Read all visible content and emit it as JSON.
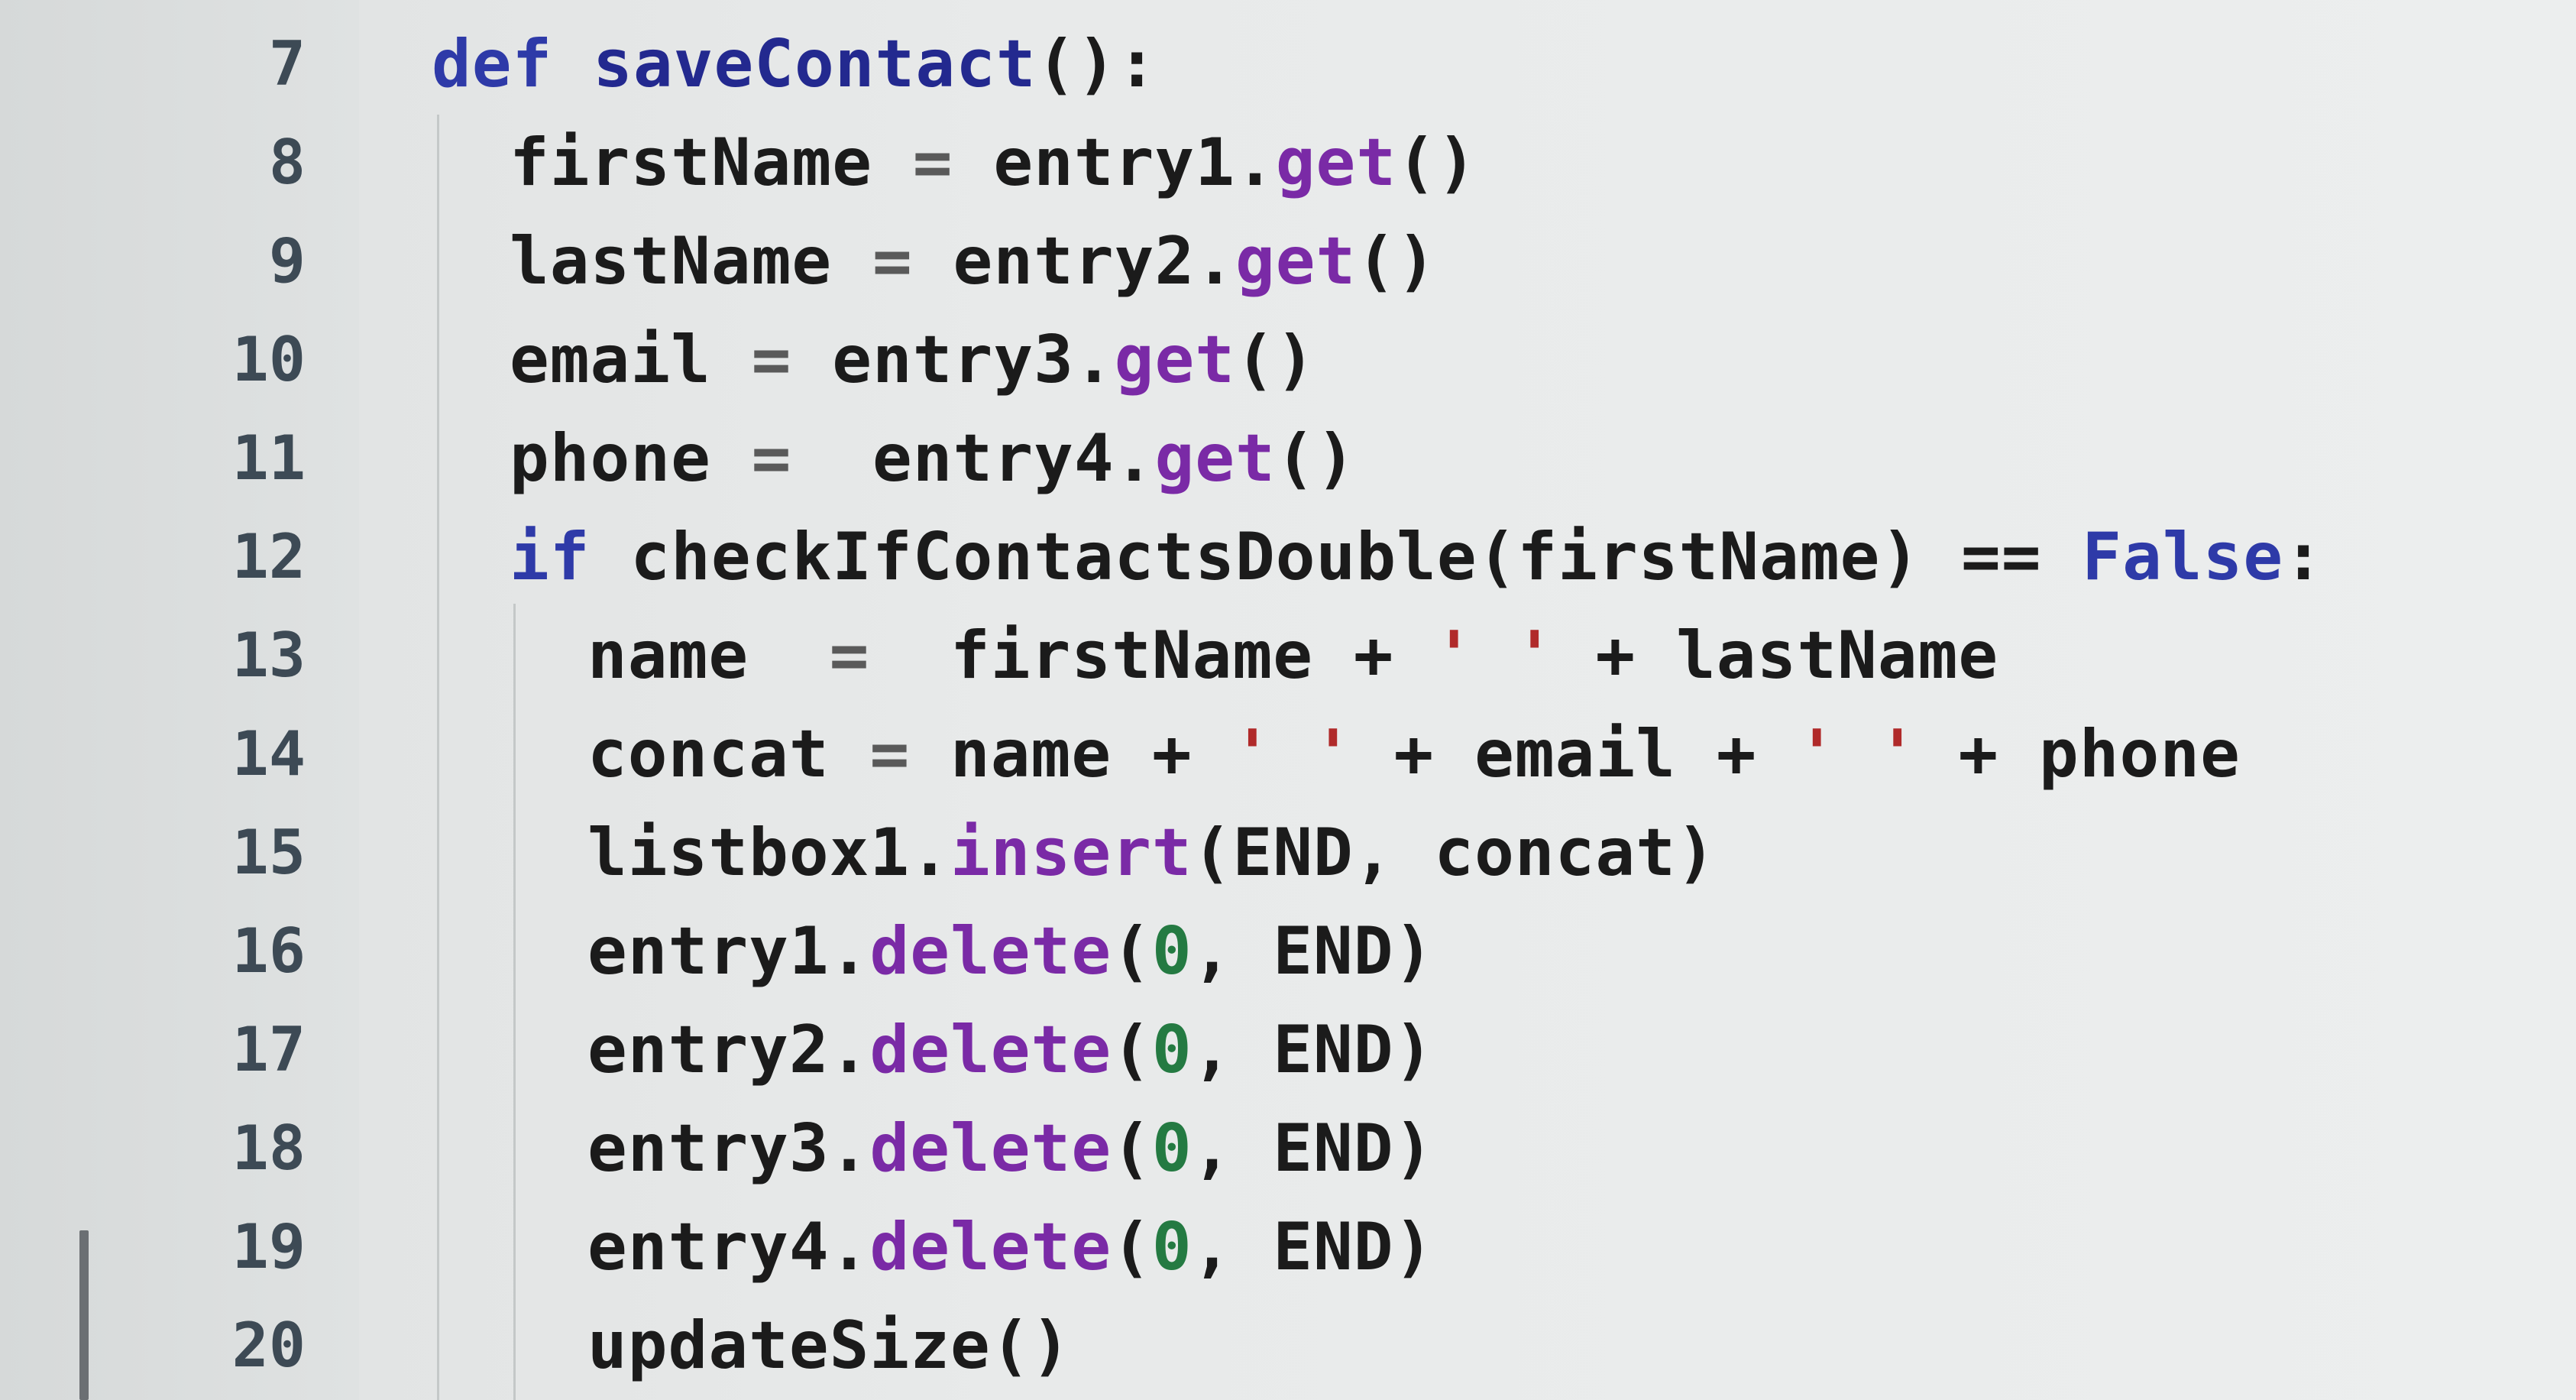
{
  "editor": {
    "colors": {
      "keyword": "#2e3aa8",
      "method": "#7a2aa6",
      "number": "#247a42",
      "string": "#b02a2a",
      "text": "#1b1b1b",
      "line_number": "#3d4a55"
    },
    "lines": [
      {
        "number": "7",
        "tokens": [
          [
            "kw",
            "def"
          ],
          [
            "t",
            " "
          ],
          [
            "fn",
            "saveContact"
          ],
          [
            "t",
            "():"
          ]
        ]
      },
      {
        "number": "8",
        "tokens": [
          [
            "t",
            "firstName "
          ],
          [
            "op",
            "="
          ],
          [
            "t",
            " entry1."
          ],
          [
            "mth",
            "get"
          ],
          [
            "t",
            "()"
          ]
        ]
      },
      {
        "number": "9",
        "tokens": [
          [
            "t",
            "lastName "
          ],
          [
            "op",
            "="
          ],
          [
            "t",
            " entry2."
          ],
          [
            "mth",
            "get"
          ],
          [
            "t",
            "()"
          ]
        ]
      },
      {
        "number": "10",
        "tokens": [
          [
            "t",
            "email "
          ],
          [
            "op",
            "="
          ],
          [
            "t",
            " entry3."
          ],
          [
            "mth",
            "get"
          ],
          [
            "t",
            "()"
          ]
        ]
      },
      {
        "number": "11",
        "tokens": [
          [
            "t",
            "phone "
          ],
          [
            "op",
            "="
          ],
          [
            "t",
            "  entry4."
          ],
          [
            "mth",
            "get"
          ],
          [
            "t",
            "()"
          ]
        ]
      },
      {
        "number": "12",
        "tokens": [
          [
            "kw",
            "if"
          ],
          [
            "t",
            " checkIfContactsDouble(firstName) == "
          ],
          [
            "const",
            "False"
          ],
          [
            "t",
            ":"
          ]
        ]
      },
      {
        "number": "13",
        "tokens": [
          [
            "t",
            "name  "
          ],
          [
            "op",
            "="
          ],
          [
            "t",
            "  firstName + "
          ],
          [
            "str",
            "' '"
          ],
          [
            "t",
            " + lastName"
          ]
        ]
      },
      {
        "number": "14",
        "tokens": [
          [
            "t",
            "concat "
          ],
          [
            "op",
            "="
          ],
          [
            "t",
            " name + "
          ],
          [
            "str",
            "' '"
          ],
          [
            "t",
            " + email + "
          ],
          [
            "str",
            "' '"
          ],
          [
            "t",
            " + phone"
          ]
        ]
      },
      {
        "number": "15",
        "tokens": [
          [
            "t",
            "listbox1."
          ],
          [
            "mth",
            "insert"
          ],
          [
            "t",
            "(END, concat)"
          ]
        ]
      },
      {
        "number": "16",
        "tokens": [
          [
            "t",
            "entry1."
          ],
          [
            "mth",
            "delete"
          ],
          [
            "t",
            "("
          ],
          [
            "num",
            "0"
          ],
          [
            "t",
            ", END)"
          ]
        ]
      },
      {
        "number": "17",
        "tokens": [
          [
            "t",
            "entry2."
          ],
          [
            "mth",
            "delete"
          ],
          [
            "t",
            "("
          ],
          [
            "num",
            "0"
          ],
          [
            "t",
            ", END)"
          ]
        ]
      },
      {
        "number": "18",
        "tokens": [
          [
            "t",
            "entry3."
          ],
          [
            "mth",
            "delete"
          ],
          [
            "t",
            "("
          ],
          [
            "num",
            "0"
          ],
          [
            "t",
            ", END)"
          ]
        ]
      },
      {
        "number": "19",
        "tokens": [
          [
            "t",
            "entry4."
          ],
          [
            "mth",
            "delete"
          ],
          [
            "t",
            "("
          ],
          [
            "num",
            "0"
          ],
          [
            "t",
            ", END)"
          ]
        ]
      },
      {
        "number": "20",
        "tokens": [
          [
            "t",
            "updateSize()"
          ]
        ]
      }
    ]
  }
}
